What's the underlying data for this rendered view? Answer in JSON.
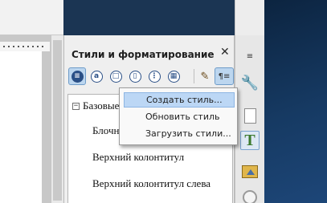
{
  "panel": {
    "title": "Стили и форматирование",
    "close_label": "✕",
    "toolbar": [
      {
        "name": "paragraph-styles",
        "glyph": "≡",
        "active": true
      },
      {
        "name": "character-styles",
        "glyph": "a",
        "active": false
      },
      {
        "name": "frame-styles",
        "glyph": "□",
        "active": false
      },
      {
        "name": "page-styles",
        "glyph": "▯",
        "active": false
      },
      {
        "name": "list-styles",
        "glyph": "⋮",
        "active": false
      },
      {
        "name": "table-styles",
        "glyph": "▦",
        "active": false
      },
      {
        "name": "fill-format-mode",
        "glyph": "✎",
        "active": false
      },
      {
        "name": "new-style-menu",
        "glyph": "¶≡",
        "active": true
      }
    ]
  },
  "style_tree": {
    "root_toggle": "−",
    "root_label": "Базовые",
    "items": [
      "Блочная",
      "Верхний колонтитул",
      "Верхний колонтитул слева"
    ]
  },
  "popup_menu": {
    "items": [
      {
        "label": "Создать стиль...",
        "highlighted": true
      },
      {
        "label": "Обновить стиль",
        "highlighted": false
      },
      {
        "label": "Загрузить стили...",
        "highlighted": false
      }
    ]
  },
  "sidebar": {
    "menu_glyph": "≡",
    "wrench_glyph": "🔧",
    "styles_glyph": "T"
  },
  "colors": {
    "accent": "#2a4f86",
    "highlight": "#bcd7f5",
    "desktop": "#163a63"
  }
}
